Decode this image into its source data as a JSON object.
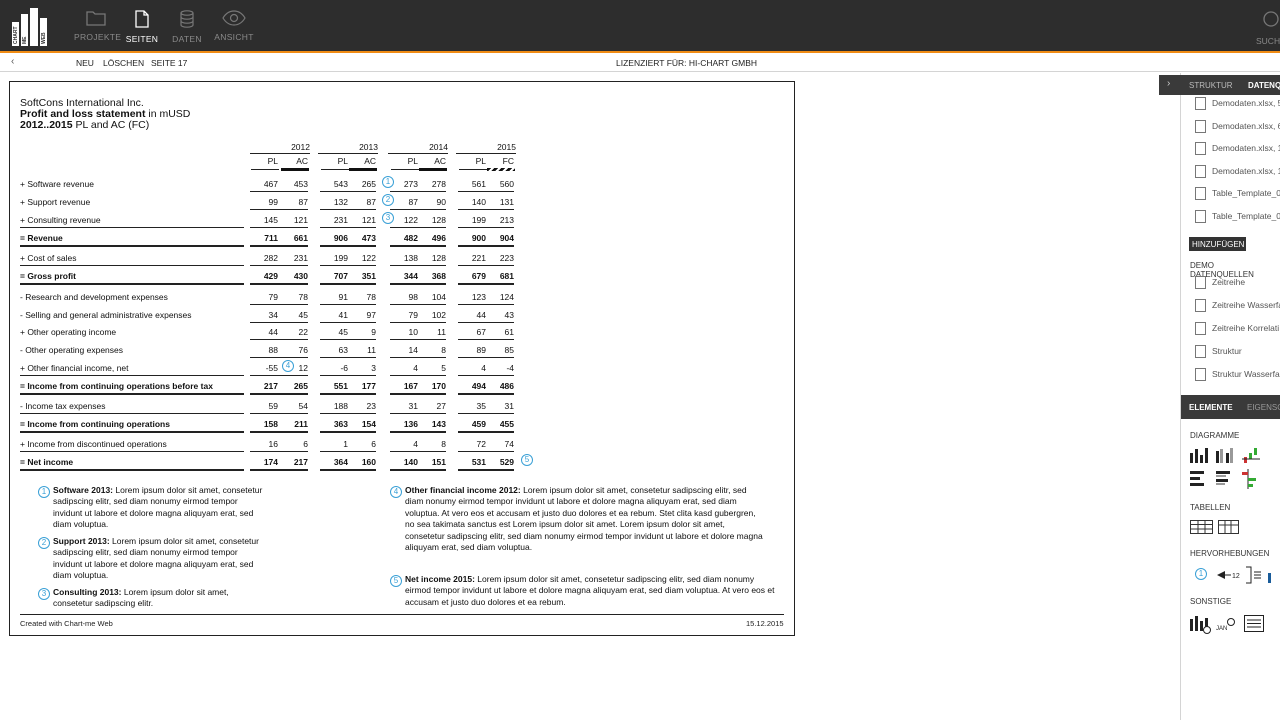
{
  "app": {
    "logo_text": "CHART ME WEB",
    "toolbar": [
      {
        "label": "PROJEKTE",
        "icon": "folder-icon"
      },
      {
        "label": "SEITEN",
        "icon": "page-icon"
      },
      {
        "label": "DATEN",
        "icon": "database-icon"
      },
      {
        "label": "ANSICHT",
        "icon": "eye-icon"
      }
    ],
    "search_label": "SUCH",
    "subbar": {
      "neu": "NEU",
      "loeschen": "LÖSCHEN",
      "page": "SEITE 17",
      "license": "LIZENZIERT FÜR: HI-CHART GMBH"
    }
  },
  "document": {
    "company": "SoftCons International Inc.",
    "title_bold": "Profit and loss statement",
    "title_rest": " in mUSD",
    "subtitle_bold": "2012..2015",
    "subtitle_rest": " PL and AC (FC)",
    "years": [
      "2012",
      "2013",
      "2014",
      "2015"
    ],
    "col_heads": [
      "PL",
      "AC",
      "PL",
      "AC",
      "PL",
      "AC",
      "PL",
      "FC"
    ],
    "rows": [
      {
        "label": "+  Software revenue",
        "values": [
          "467",
          "453",
          "543",
          "265",
          "273",
          "278",
          "561",
          "560"
        ]
      },
      {
        "label": "+  Support revenue",
        "values": [
          "99",
          "87",
          "132",
          "87",
          "87",
          "90",
          "140",
          "131"
        ]
      },
      {
        "label": "+  Consulting revenue",
        "values": [
          "145",
          "121",
          "231",
          "121",
          "122",
          "128",
          "199",
          "213"
        ]
      },
      {
        "label": "= Revenue",
        "values": [
          "711",
          "661",
          "906",
          "473",
          "482",
          "496",
          "900",
          "904"
        ],
        "bold": true
      },
      {
        "label": "+  Cost of sales",
        "values": [
          "282",
          "231",
          "199",
          "122",
          "138",
          "128",
          "221",
          "223"
        ]
      },
      {
        "label": "= Gross profit",
        "values": [
          "429",
          "430",
          "707",
          "351",
          "344",
          "368",
          "679",
          "681"
        ],
        "bold": true
      },
      {
        "label": "-  Research and development expenses",
        "values": [
          "79",
          "78",
          "91",
          "78",
          "98",
          "104",
          "123",
          "124"
        ]
      },
      {
        "label": "-  Selling and general administrative expenses",
        "values": [
          "34",
          "45",
          "41",
          "97",
          "79",
          "102",
          "44",
          "43"
        ]
      },
      {
        "label": "+  Other operating income",
        "values": [
          "44",
          "22",
          "45",
          "9",
          "10",
          "11",
          "67",
          "61"
        ]
      },
      {
        "label": "-  Other operating expenses",
        "values": [
          "88",
          "76",
          "63",
          "11",
          "14",
          "8",
          "89",
          "85"
        ]
      },
      {
        "label": "+  Other financial income, net",
        "values": [
          "-55",
          "12",
          "-6",
          "3",
          "4",
          "5",
          "4",
          "-4"
        ]
      },
      {
        "label": "= Income from continuing operations before tax",
        "values": [
          "217",
          "265",
          "551",
          "177",
          "167",
          "170",
          "494",
          "486"
        ],
        "bold": true
      },
      {
        "label": "-  Income tax expenses",
        "values": [
          "59",
          "54",
          "188",
          "23",
          "31",
          "27",
          "35",
          "31"
        ]
      },
      {
        "label": "= Income from continuing operations",
        "values": [
          "158",
          "211",
          "363",
          "154",
          "136",
          "143",
          "459",
          "455"
        ],
        "bold": true
      },
      {
        "label": "+  Income from discontinued operations",
        "values": [
          "16",
          "6",
          "1",
          "6",
          "4",
          "8",
          "72",
          "74"
        ]
      },
      {
        "label": "= Net income",
        "values": [
          "174",
          "217",
          "364",
          "160",
          "140",
          "151",
          "531",
          "529"
        ],
        "bold": true
      }
    ],
    "markers": [
      "1",
      "2",
      "3",
      "4",
      "5"
    ],
    "notes": [
      {
        "num": "1",
        "head": "Software 2013:",
        "body": " Lorem ipsum dolor sit amet, consetetur sadipscing elitr, sed diam nonumy eirmod tempor invidunt ut labore et dolore magna aliquyam erat, sed diam voluptua."
      },
      {
        "num": "2",
        "head": "Support 2013:",
        "body": " Lorem ipsum dolor sit amet, consetetur sadipscing elitr, sed diam nonumy eirmod tempor invidunt ut labore et dolore magna aliquyam erat, sed diam voluptua."
      },
      {
        "num": "3",
        "head": "Consulting 2013:",
        "body": " Lorem ipsum dolor sit amet, consetetur sadipscing elitr."
      },
      {
        "num": "4",
        "head": "Other financial income 2012:",
        "body": " Lorem ipsum dolor sit amet, consetetur sadipscing elitr, sed diam nonumy eirmod tempor invidunt ut labore et dolore magna aliquyam erat, sed diam voluptua. At vero eos et accusam et justo duo dolores et ea rebum. Stet clita kasd gubergren, no sea takimata sanctus est Lorem ipsum dolor sit amet. Lorem ipsum dolor sit amet, consetetur sadipscing elitr, sed diam nonumy eirmod tempor invidunt ut labore et dolore magna aliquyam erat, sed diam voluptua."
      },
      {
        "num": "5",
        "head": "Net income 2015:",
        "body": " Lorem ipsum dolor sit amet, consetetur sadipscing elitr, sed diam nonumy eirmod tempor invidunt ut labore et dolore magna aliquyam erat, sed diam voluptua. At vero eos et accusam et justo duo dolores et ea rebum."
      }
    ],
    "footer_left": "Created with Chart-me Web",
    "footer_right": "15.12.2015"
  },
  "right_panel": {
    "tabs": [
      "STRUKTUR",
      "DATENQ"
    ],
    "files": [
      "Demodaten.xlsx, 5",
      "Demodaten.xlsx, 6",
      "Demodaten.xlsx, 1",
      "Demodaten.xlsx, 1",
      "Table_Template_0",
      "Table_Template_0"
    ],
    "add_button": "HINZUFÜGEN",
    "demo_heading": "DEMO DATENQUELLEN",
    "demo_items": [
      "Zeitreihe",
      "Zeitreihe Wasserfa",
      "Zeitreihe Korrelati",
      "Struktur",
      "Struktur Wasserfa"
    ],
    "element_tabs": [
      "ELEMENTE",
      "EIGENSC"
    ],
    "sections": [
      "DIAGRAMME",
      "TABELLEN",
      "HERVORHEBUNGEN",
      "SONSTIGE"
    ],
    "highlight_marker": "1",
    "highlight_label": "12",
    "jan_label": "JAN"
  }
}
